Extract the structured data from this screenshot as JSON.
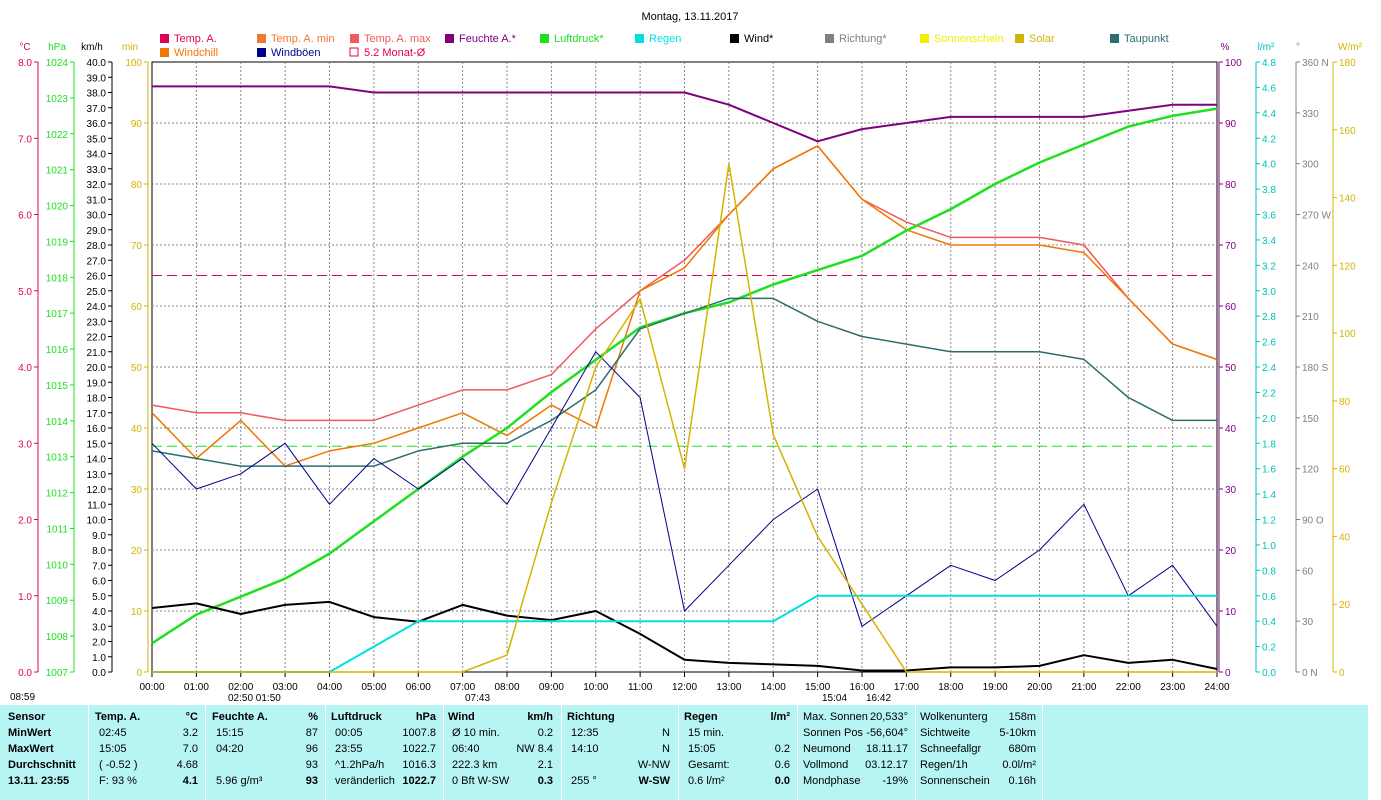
{
  "title": "Montag, 13.11.2017",
  "legend": [
    {
      "label": "Temp. A.",
      "color": "#e0005a"
    },
    {
      "label": "Temp. A. min",
      "color": "#f07830"
    },
    {
      "label": "Temp. A. max",
      "color": "#f05a5a"
    },
    {
      "label": "Feuchte A.*",
      "color": "#800080"
    },
    {
      "label": "Luftdruck*",
      "color": "#1ee01e"
    },
    {
      "label": "Regen",
      "color": "#00e0e0"
    },
    {
      "label": "Wind*",
      "color": "#000000"
    },
    {
      "label": "Richtung*",
      "color": "#808080"
    },
    {
      "label": "Sonnenschein",
      "color": "#f0f000"
    },
    {
      "label": "Solar",
      "color": "#d4b400"
    },
    {
      "label": "Taupunkt",
      "color": "#2e6e6e"
    },
    {
      "label": "Windchill",
      "color": "#f07800"
    },
    {
      "label": "Windböen",
      "color": "#00008c"
    },
    {
      "label": "5.2 Monat-Ø",
      "color": "#e0005a"
    }
  ],
  "axes": {
    "left_units": [
      "°C",
      "hPa",
      "km/h",
      "min"
    ],
    "right_units": [
      "%",
      "l/m²",
      "°",
      "W/m²"
    ],
    "temp_ticks": [
      "8.0",
      "7.0",
      "6.0",
      "5.0",
      "4.0",
      "3.0",
      "2.0",
      "1.0",
      "0.0"
    ],
    "hpa_ticks": [
      "1024",
      "1023",
      "1022",
      "1021",
      "1020",
      "1019",
      "1018",
      "1017",
      "1016",
      "1015",
      "1014",
      "1013",
      "1012",
      "1011",
      "1010",
      "1009",
      "1008",
      "1007"
    ],
    "kmh_ticks": [
      "40.0",
      "39.0",
      "38.0",
      "37.0",
      "36.0",
      "35.0",
      "34.0",
      "33.0",
      "32.0",
      "31.0",
      "30.0",
      "29.0",
      "28.0",
      "27.0",
      "26.0",
      "25.0",
      "24.0",
      "23.0",
      "22.0",
      "21.0",
      "20.0",
      "19.0",
      "18.0",
      "17.0",
      "16.0",
      "15.0",
      "14.0",
      "13.0",
      "12.0",
      "11.0",
      "10.0",
      "9.0",
      "8.0",
      "7.0",
      "6.0",
      "5.0",
      "4.0",
      "3.0",
      "2.0",
      "1.0",
      "0.0"
    ],
    "min_ticks": [
      "100",
      "90",
      "80",
      "70",
      "60",
      "50",
      "40",
      "30",
      "20",
      "10",
      "0"
    ],
    "pct_ticks": [
      "100",
      "90",
      "80",
      "70",
      "60",
      "50",
      "40",
      "30",
      "20",
      "10",
      "0"
    ],
    "rain_ticks": [
      "4.8",
      "4.6",
      "4.4",
      "4.2",
      "4.0",
      "3.8",
      "3.6",
      "3.4",
      "3.2",
      "3.0",
      "2.8",
      "2.6",
      "2.4",
      "2.2",
      "2.0",
      "1.8",
      "1.6",
      "1.4",
      "1.2",
      "1.0",
      "0.8",
      "0.6",
      "0.4",
      "0.2",
      "0.0"
    ],
    "deg_ticks": [
      "360 N",
      "330",
      "300",
      "270 W",
      "240",
      "210",
      "180 S",
      "150",
      "120",
      "90 O",
      "60",
      "30",
      "0 N"
    ],
    "wm2_ticks": [
      "180",
      "160",
      "140",
      "120",
      "100",
      "80",
      "60",
      "40",
      "20",
      "0"
    ],
    "x_ticks": [
      "00:00",
      "01:00",
      "02:00",
      "03:00",
      "04:00",
      "05:00",
      "06:00",
      "07:00",
      "08:00",
      "09:00",
      "10:00",
      "11:00",
      "12:00",
      "13:00",
      "14:00",
      "15:00",
      "16:00",
      "17:00",
      "18:00",
      "19:00",
      "20:00",
      "21:00",
      "22:00",
      "23:00",
      "24:00"
    ]
  },
  "sun_marks": {
    "sunrise_left": "08:59",
    "sunrise": "07:43",
    "noon_minus": "02:50 01:50",
    "sunset": "15:04",
    "sunset2": "16:42"
  },
  "chart_data": {
    "type": "line",
    "x": [
      "00:00",
      "01:00",
      "02:00",
      "03:00",
      "04:00",
      "05:00",
      "06:00",
      "07:00",
      "08:00",
      "09:00",
      "10:00",
      "11:00",
      "12:00",
      "13:00",
      "14:00",
      "15:00",
      "16:00",
      "17:00",
      "18:00",
      "19:00",
      "20:00",
      "21:00",
      "22:00",
      "23:00",
      "24:00"
    ],
    "series": [
      {
        "name": "Temp. A.",
        "unit": "°C",
        "values": [
          3.5,
          3.4,
          3.4,
          3.3,
          3.3,
          3.3,
          3.5,
          3.7,
          3.7,
          3.9,
          4.5,
          5.0,
          5.4,
          6.0,
          6.6,
          6.9,
          6.2,
          5.9,
          5.7,
          5.7,
          5.7,
          5.6,
          4.9,
          4.3,
          4.1
        ]
      },
      {
        "name": "Windchill",
        "unit": "°C",
        "values": [
          3.4,
          2.8,
          3.3,
          2.7,
          2.9,
          3.0,
          3.2,
          3.4,
          3.1,
          3.5,
          3.2,
          5.0,
          5.3,
          6.0,
          6.6,
          6.9,
          6.2,
          5.8,
          5.6,
          5.6,
          5.6,
          5.5,
          4.9,
          4.3,
          4.1
        ]
      },
      {
        "name": "Feuchte A.*",
        "unit": "%",
        "values": [
          96,
          96,
          96,
          96,
          96,
          95,
          95,
          95,
          95,
          95,
          95,
          95,
          95,
          93,
          90,
          87,
          89,
          90,
          91,
          91,
          91,
          91,
          92,
          93,
          93
        ]
      },
      {
        "name": "Luftdruck*",
        "unit": "hPa",
        "values": [
          1007.8,
          1008.6,
          1009.1,
          1009.6,
          1010.3,
          1011.2,
          1012.1,
          1013.0,
          1013.8,
          1014.8,
          1015.7,
          1016.6,
          1017.0,
          1017.3,
          1017.8,
          1018.2,
          1018.6,
          1019.3,
          1019.9,
          1020.6,
          1021.2,
          1021.7,
          1022.2,
          1022.5,
          1022.7
        ]
      },
      {
        "name": "Taupunkt",
        "unit": "°C",
        "values": [
          2.9,
          2.8,
          2.7,
          2.7,
          2.7,
          2.7,
          2.9,
          3.0,
          3.0,
          3.3,
          3.7,
          4.5,
          4.7,
          4.9,
          4.9,
          4.6,
          4.4,
          4.3,
          4.2,
          4.2,
          4.2,
          4.1,
          3.6,
          3.3,
          3.3
        ]
      },
      {
        "name": "Wind*",
        "unit": "km/h",
        "values": [
          4.2,
          4.5,
          3.8,
          4.4,
          4.6,
          3.6,
          3.3,
          4.4,
          3.7,
          3.4,
          4.0,
          2.5,
          0.8,
          0.6,
          0.5,
          0.4,
          0.1,
          0.1,
          0.3,
          0.3,
          0.4,
          1.1,
          0.6,
          0.8,
          0.2
        ]
      },
      {
        "name": "Windböen",
        "unit": "km/h",
        "values": [
          15,
          12,
          13,
          15,
          11,
          14,
          12,
          14,
          11,
          16,
          21,
          18,
          4,
          7,
          10,
          12,
          3,
          5,
          7,
          6,
          8,
          11,
          5,
          7,
          3
        ]
      },
      {
        "name": "Regen",
        "unit": "l/m²",
        "values": [
          0,
          0,
          0,
          0,
          0,
          0.2,
          0.4,
          0.4,
          0.4,
          0.4,
          0.4,
          0.4,
          0.4,
          0.4,
          0.4,
          0.6,
          0.6,
          0.6,
          0.6,
          0.6,
          0.6,
          0.6,
          0.6,
          0.6,
          0.6
        ]
      },
      {
        "name": "Solar",
        "unit": "W/m²",
        "values": [
          0,
          0,
          0,
          0,
          0,
          0,
          0,
          0,
          5,
          50,
          90,
          110,
          60,
          150,
          70,
          40,
          20,
          0,
          0,
          0,
          0,
          0,
          0,
          0,
          0
        ]
      }
    ],
    "ref_lines": {
      "temp_monthly_avg": 5.2,
      "pressure_avg": 1018.0,
      "humidity_avg": 37
    },
    "ylim_temp": [
      0,
      8
    ],
    "ylim_hpa": [
      1007,
      1024
    ],
    "ylim_kmh": [
      0,
      40
    ],
    "ylim_pct": [
      0,
      100
    ],
    "ylim_rain": [
      0,
      5
    ],
    "ylim_wm2": [
      0,
      180
    ]
  },
  "stats": {
    "col_sensor": [
      "Sensor",
      "MinWert",
      "MaxWert",
      "Durchschnitt",
      "13.11. 23:55"
    ],
    "temp": {
      "head": "Temp. A.",
      "unit": "°C",
      "rows": [
        [
          "02:45",
          "3.2"
        ],
        [
          "15:05",
          "7.0"
        ],
        [
          "( -0.52 )",
          "4.68"
        ],
        [
          "F: 93 %",
          "4.1"
        ]
      ]
    },
    "feuchte": {
      "head": "Feuchte A.",
      "unit": "%",
      "rows": [
        [
          "15:15",
          "87"
        ],
        [
          "04:20",
          "96"
        ],
        [
          "",
          "93"
        ],
        [
          "5.96 g/m³",
          "93"
        ]
      ]
    },
    "druck": {
      "head": "Luftdruck",
      "unit": "hPa",
      "rows": [
        [
          "00:05",
          "1007.8"
        ],
        [
          "23:55",
          "1022.7"
        ],
        [
          "^1.2hPa/h",
          "1016.3"
        ],
        [
          "veränderlich",
          "1022.7"
        ]
      ]
    },
    "wind": {
      "head": "Wind",
      "unit": "km/h",
      "rows": [
        [
          "Ø 10 min.",
          "0.2"
        ],
        [
          "06:40",
          "NW 8.4"
        ],
        [
          "222.3 km",
          "2.1"
        ],
        [
          "0 Bft W-SW",
          "0.3"
        ]
      ]
    },
    "richtung": {
      "head": "Richtung",
      "rows": [
        [
          "12:35",
          "N"
        ],
        [
          "14:10",
          "N"
        ],
        [
          "",
          "W-NW"
        ],
        [
          "255 °",
          "W-SW"
        ]
      ]
    },
    "regen": {
      "head": "Regen",
      "unit": "l/m²",
      "rows": [
        [
          "15 min.",
          ""
        ],
        [
          "15:05",
          "0.2"
        ],
        [
          "Gesamt:",
          "0.6"
        ],
        [
          "0.6 l/m²",
          "0.0"
        ]
      ]
    },
    "sonne": {
      "rows": [
        [
          "Max. Sonnen",
          "20,533°"
        ],
        [
          "Sonnen Pos",
          "-56,604°"
        ],
        [
          "Neumond",
          "18.11.17"
        ],
        [
          "Vollmond",
          "03.12.17"
        ],
        [
          "Mondphase",
          "-19%"
        ]
      ]
    },
    "extra": {
      "rows": [
        [
          "Wolkenunterg",
          "158m"
        ],
        [
          "Sichtweite",
          "5-10km"
        ],
        [
          "Schneefallgr",
          "680m"
        ],
        [
          "Regen/1h",
          "0.0l/m²"
        ],
        [
          "Sonnenschein",
          "0.16h"
        ]
      ]
    }
  }
}
